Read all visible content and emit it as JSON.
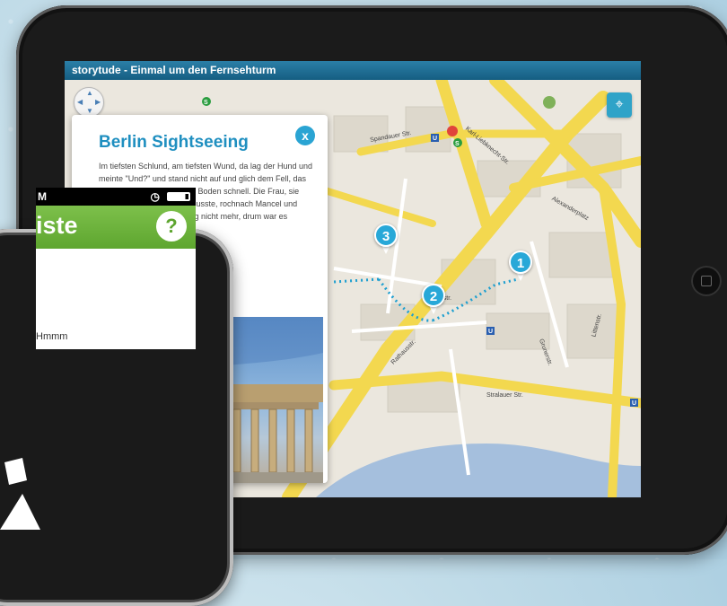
{
  "tablet": {
    "title": "storytude - Einmal um den Fernsehturm",
    "map": {
      "labels": [
        "Karl-Liebknecht-Str.",
        "Alexanderplatz",
        "Spandauer Str.",
        "Stralauer Str.",
        "Rathausstr.",
        "Grunerstr.",
        "Littenstr.",
        "Klosterstr."
      ],
      "pins": [
        "1",
        "2",
        "3"
      ],
      "locate_icon": "location-pin-icon",
      "nav_icon": "pan-control-icon"
    },
    "info_panel": {
      "title": "Berlin Sightseeing",
      "close_label": "x",
      "body": "Im tiefsten Schlund, am tiefsten Wund, da lag der Hund und meinte \"Und?\" und stand nicht auf und glich dem Fell, das dort lag vor dem Kamin am Boden schnell. Die Frau, sie kam, sowelt sie kommen musste, rochnach Mancel und nach Öl, weil sie schon lang nicht mehr, drum war es",
      "photo_alt": "Brandenburger Tor"
    }
  },
  "phone": {
    "status_time": "M",
    "header_title": "iste",
    "help_label": "?",
    "row_text": "Hmmm"
  },
  "colors": {
    "accent_blue": "#28a8d8",
    "title_bar": "#155e82",
    "phone_green": "#5ea62f",
    "route_dots": "#1e9fd0"
  }
}
